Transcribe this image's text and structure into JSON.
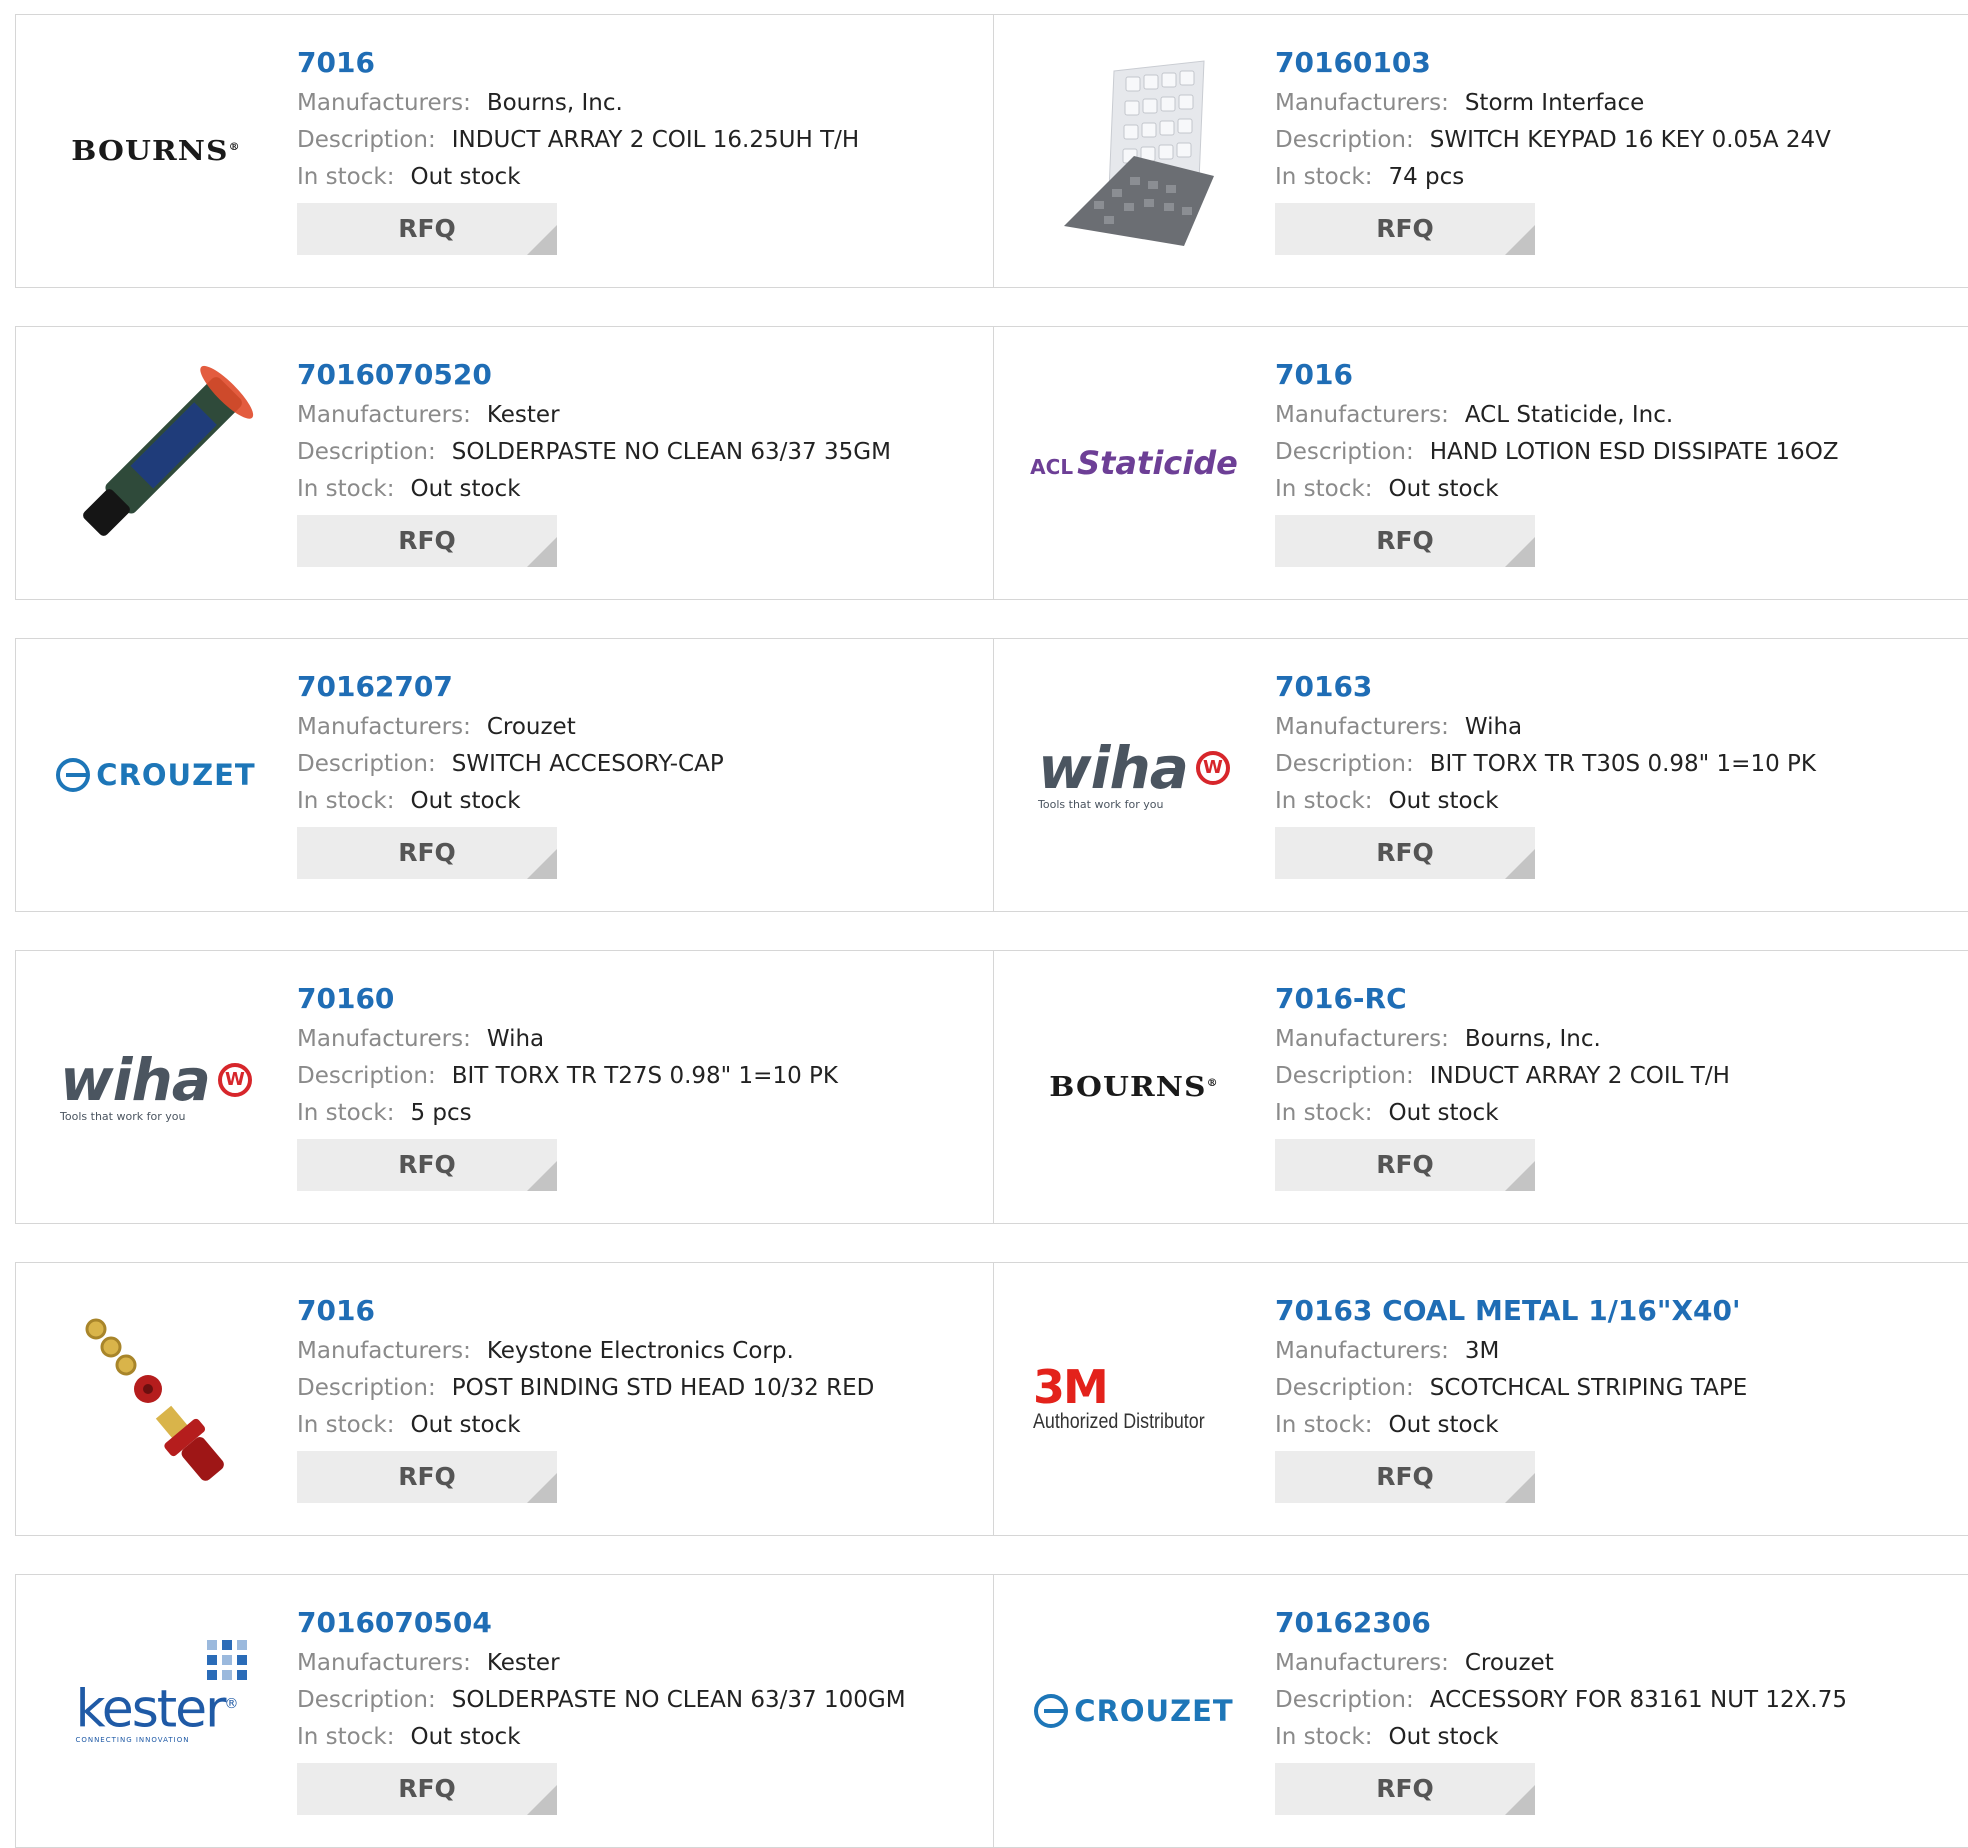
{
  "labels": {
    "manufacturers": "Manufacturers:",
    "description": "Description:",
    "in_stock": "In stock:",
    "rfq": "RFQ"
  },
  "products": [
    {
      "part": "7016",
      "manufacturer": "Bourns, Inc.",
      "description": "INDUCT ARRAY 2 COIL 16.25UH T/H",
      "stock": "Out stock",
      "logo": "BOURNS",
      "logo_mark": "®"
    },
    {
      "part": "70160103",
      "manufacturer": "Storm Interface",
      "description": "SWITCH KEYPAD 16 KEY 0.05A 24V",
      "stock": "74 pcs",
      "image": "keypad-image"
    },
    {
      "part": "7016070520",
      "manufacturer": "Kester",
      "description": "SOLDERPASTE NO CLEAN 63/37 35GM",
      "stock": "Out stock",
      "image": "solder-syringe-image"
    },
    {
      "part": "7016",
      "manufacturer": "ACL Staticide, Inc.",
      "description": "HAND LOTION ESD DISSIPATE 16OZ",
      "stock": "Out stock",
      "logo_small": "ACL",
      "logo": "Staticide"
    },
    {
      "part": "70162707",
      "manufacturer": "Crouzet",
      "description": "SWITCH ACCESORY-CAP",
      "stock": "Out stock",
      "logo": "CROUZET"
    },
    {
      "part": "70163",
      "manufacturer": "Wiha",
      "description": "BIT TORX TR T30S 0.98\" 1=10 PK",
      "stock": "Out stock",
      "logo": "wiha",
      "logo_tag": "Tools that work for you"
    },
    {
      "part": "70160",
      "manufacturer": "Wiha",
      "description": "BIT TORX TR T27S 0.98\" 1=10 PK",
      "stock": "5 pcs",
      "logo": "wiha",
      "logo_tag": "Tools that work for you"
    },
    {
      "part": "7016-RC",
      "manufacturer": "Bourns, Inc.",
      "description": "INDUCT ARRAY 2 COIL T/H",
      "stock": "Out stock",
      "logo": "BOURNS",
      "logo_mark": "®"
    },
    {
      "part": "7016",
      "manufacturer": "Keystone Electronics Corp.",
      "description": "POST BINDING STD HEAD 10/32 RED",
      "stock": "Out stock",
      "image": "binding-post-image"
    },
    {
      "part": "70163 COAL METAL 1/16\"X40'",
      "manufacturer": "3M",
      "description": "SCOTCHCAL STRIPING TAPE",
      "stock": "Out stock",
      "logo": "3M",
      "logo_tag": "Authorized Distributor"
    },
    {
      "part": "7016070504",
      "manufacturer": "Kester",
      "description": "SOLDERPASTE NO CLEAN 63/37 100GM",
      "stock": "Out stock",
      "logo": "kester",
      "logo_mark": "®",
      "logo_tag": "CONNECTING INNOVATION"
    },
    {
      "part": "70162306",
      "manufacturer": "Crouzet",
      "description": "ACCESSORY FOR 83161 NUT 12X.75",
      "stock": "Out stock",
      "logo": "CROUZET"
    }
  ]
}
